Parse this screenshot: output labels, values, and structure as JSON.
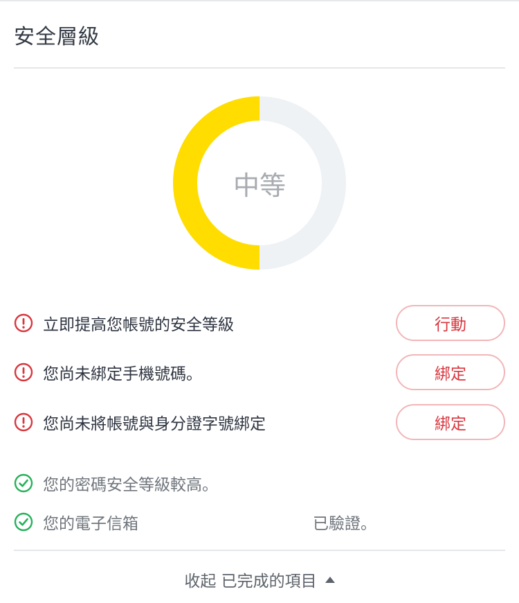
{
  "section": {
    "title": "安全層級"
  },
  "security_level": {
    "label": "中等",
    "progress": 0.5,
    "fill_color": "#FFDD00",
    "track_color": "#EEF2F5"
  },
  "alerts": [
    {
      "text": "立即提高您帳號的安全等級",
      "action": "行動",
      "icon": "exclamation-circle-icon"
    },
    {
      "text": "您尚未綁定手機號碼。",
      "action": "綁定",
      "icon": "exclamation-circle-icon"
    },
    {
      "text": "您尚未將帳號與身分證字號綁定",
      "action": "綁定",
      "icon": "exclamation-circle-icon"
    }
  ],
  "completed": [
    {
      "text": "您的密碼安全等級較高。",
      "icon": "check-circle-icon"
    },
    {
      "text": "您的電子信箱",
      "suffix": "已驗證。",
      "icon": "check-circle-icon"
    }
  ],
  "collapse": {
    "label": "收起 已完成的項目",
    "icon": "caret-up-icon"
  },
  "colors": {
    "alert_red": "#D9363E",
    "success_green": "#25B15B",
    "button_border": "#F2B5B8"
  }
}
